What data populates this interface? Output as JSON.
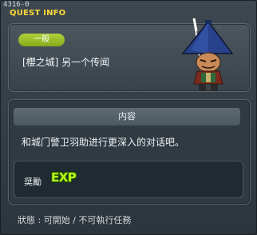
{
  "quest_id": "4316-0",
  "window_title": "QUEST INFO",
  "category_badge": "一般",
  "quest_name": "[櫻之城] 另一个传闻",
  "content_header": "内容",
  "description": "和城门警卫羽助进行更深入的对话吧。",
  "reward_label": "奨勵",
  "reward_exp": "EXP",
  "status_text": "狀態 : 可開始 / 不可執行任務",
  "colors": {
    "accent": "#ffd83a",
    "badge": "#9cc12a",
    "exp": "#b6ff1c"
  },
  "icons": {
    "npc": "straw-hat-samurai-npc-icon"
  }
}
